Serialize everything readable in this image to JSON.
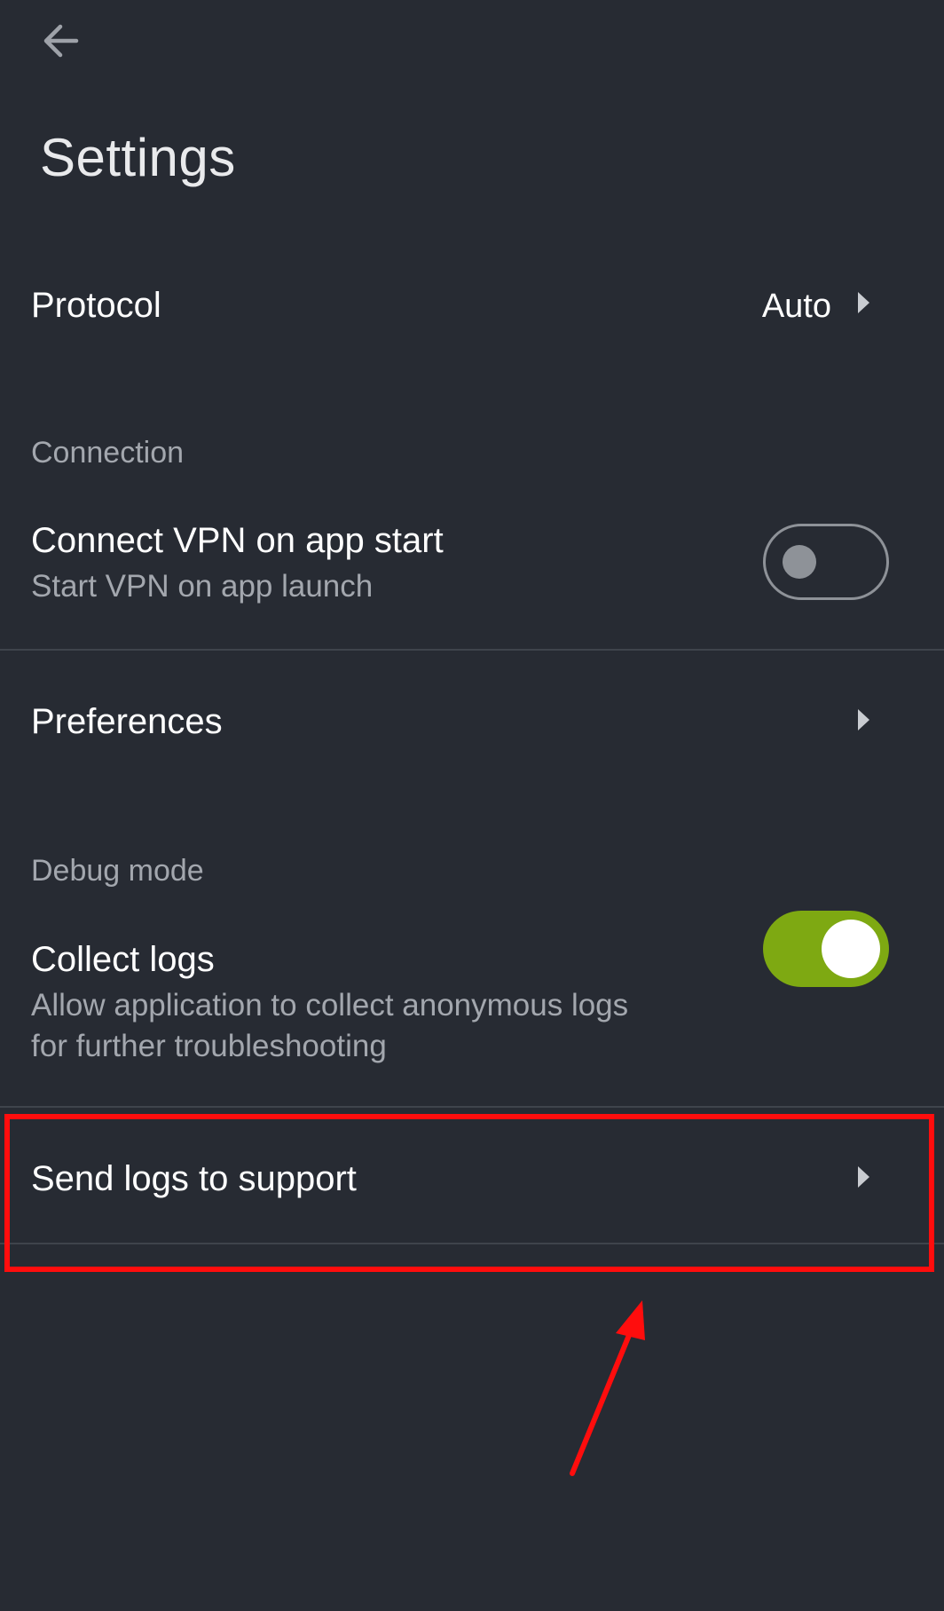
{
  "header": {
    "back_icon": "arrow-left-icon",
    "title": "Settings"
  },
  "protocol": {
    "label": "Protocol",
    "value": "Auto",
    "chevron_icon": "chevron-right-icon"
  },
  "connection": {
    "section_label": "Connection",
    "connect_on_start": {
      "title": "Connect VPN on app start",
      "subtitle": "Start VPN on app launch",
      "enabled": false
    }
  },
  "preferences": {
    "label": "Preferences",
    "chevron_icon": "chevron-right-icon"
  },
  "debug": {
    "section_label": "Debug mode",
    "collect_logs": {
      "title": "Collect logs",
      "subtitle_line1": "Allow application to collect anonymous logs",
      "subtitle_line2": "for further troubleshooting",
      "enabled": true
    },
    "send_logs": {
      "label": "Send logs to support",
      "chevron_icon": "chevron-right-icon"
    }
  },
  "annotation": {
    "highlight_color": "#ff0d0d",
    "arrow_icon": "arrow-up-icon"
  },
  "colors": {
    "background": "#272b33",
    "accent_toggle": "#7ea912",
    "secondary_text": "#a3a7ae"
  }
}
